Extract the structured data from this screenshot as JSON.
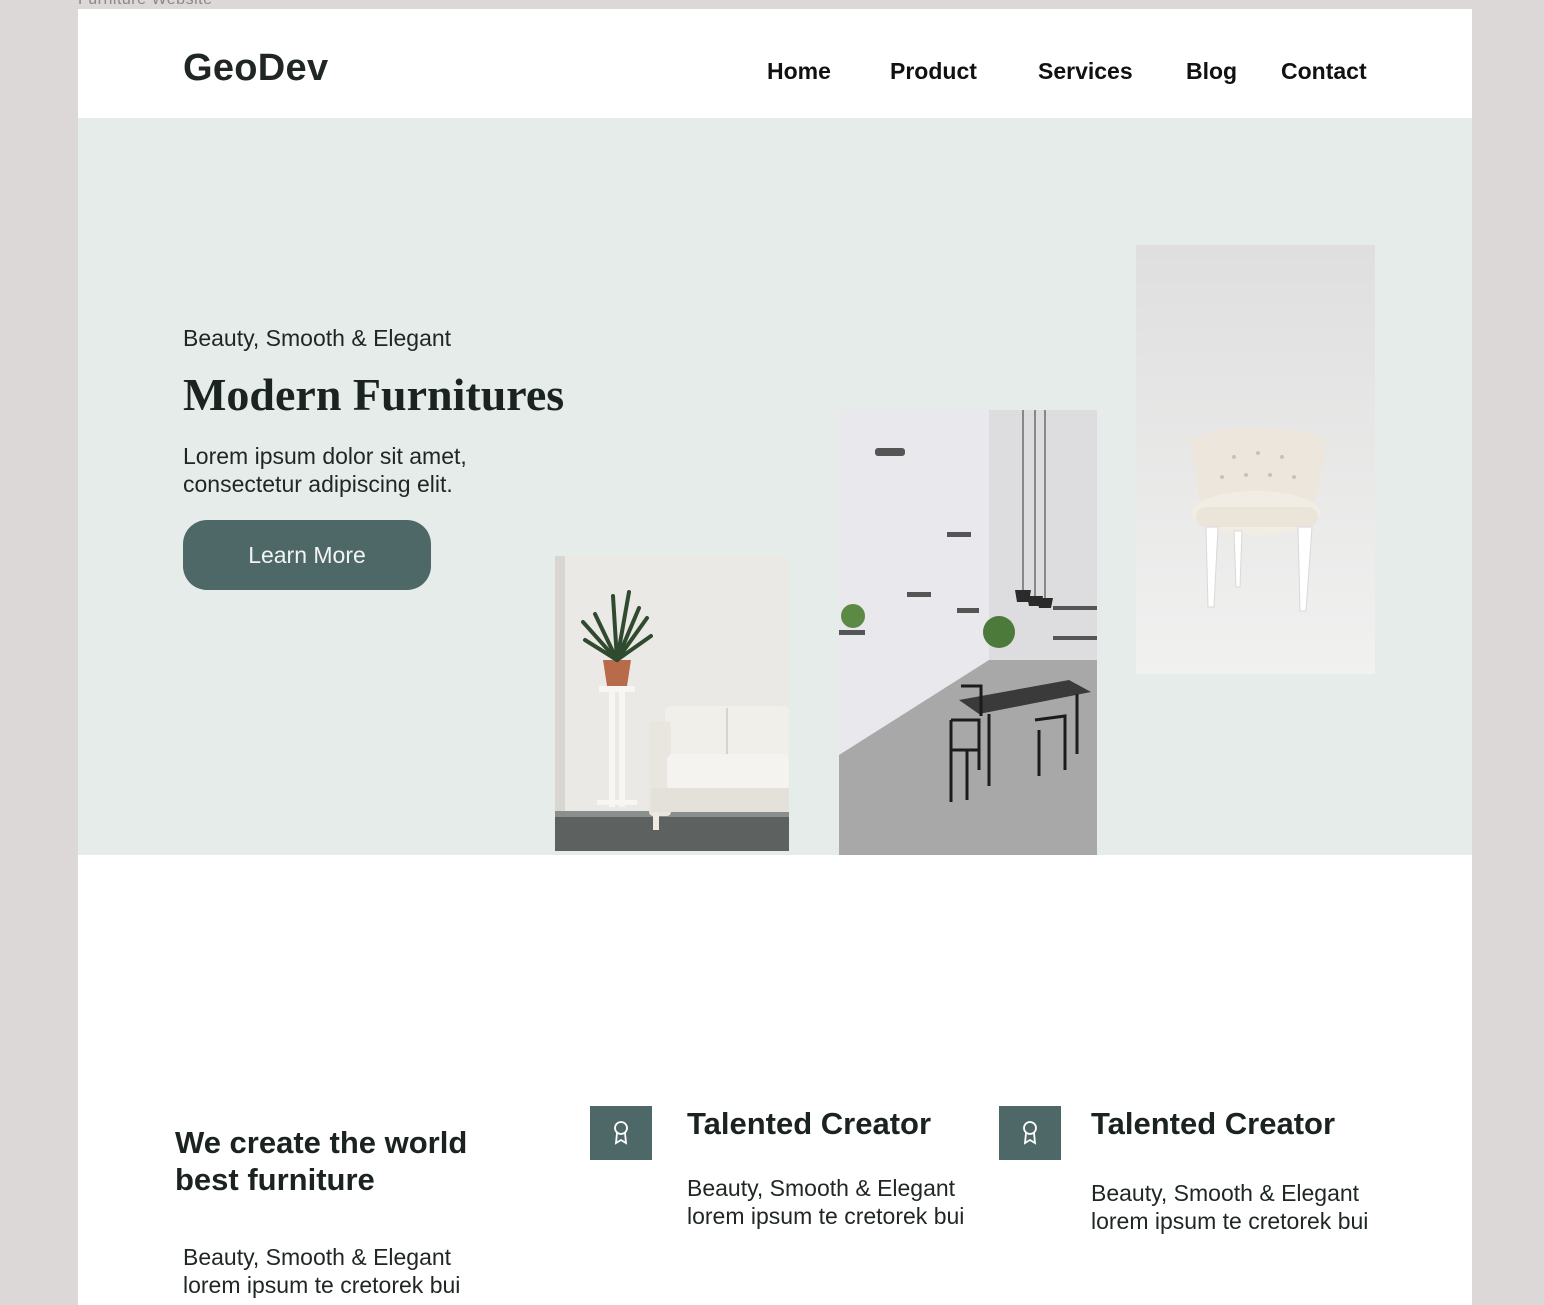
{
  "frame": {
    "label": "Furniture Website"
  },
  "header": {
    "logo": "GeoDev",
    "nav": [
      "Home",
      "Product",
      "Services",
      "Blog",
      "Contact"
    ]
  },
  "hero": {
    "tagline": "Beauty, Smooth & Elegant",
    "title": "Modern Furnitures",
    "description": "Lorem ipsum dolor sit amet, consectetur adipiscing elit.",
    "button": "Learn More"
  },
  "features": {
    "heading": "We create the world best furniture",
    "body_line1": "Beauty, Smooth & Elegant",
    "body_line2": "lorem ipsum te cretorek bui",
    "cards": [
      {
        "icon": "award-icon",
        "title": "Talented Creator",
        "line1": "Beauty, Smooth & Elegant",
        "line2": "lorem ipsum te cretorek bui"
      },
      {
        "icon": "award-icon",
        "title": "Talented Creator",
        "line1": "Beauty, Smooth & Elegant",
        "line2": "lorem ipsum te cretorek bui"
      }
    ]
  },
  "colors": {
    "accent": "#4d6866",
    "hero_bg": "#e6ece9",
    "page_bg": "#ffffff",
    "outer_bg": "#dcd8d8",
    "text": "#1f2623"
  }
}
